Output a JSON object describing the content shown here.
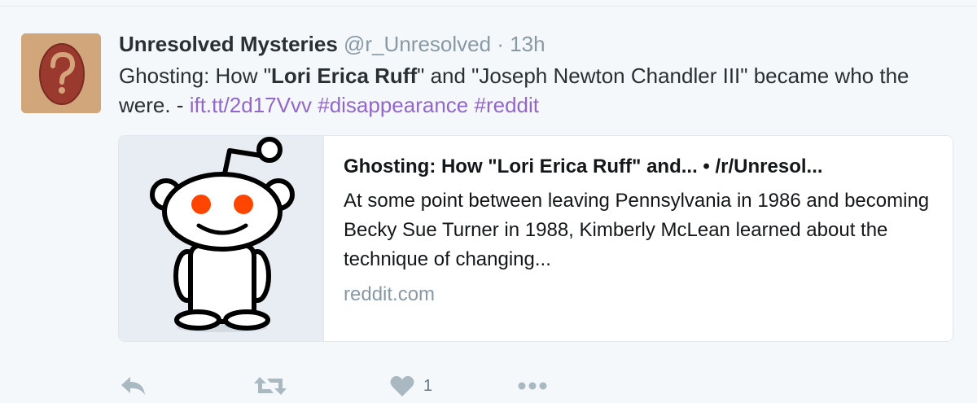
{
  "tweet": {
    "fullname": "Unresolved Mysteries",
    "username": "@r_Unresolved",
    "separator": "·",
    "time": "13h",
    "text_prefix": "Ghosting: How \"",
    "bold_1": "Lori Erica Ruff",
    "text_middle": "\" and \"Joseph Newton Chandler III\" became who the were. - ",
    "link": "ift.tt/2d17Vvv",
    "hashtag_1": "#disappearance",
    "hashtag_2": "#reddit"
  },
  "card": {
    "title": "Ghosting: How \"Lori Erica Ruff\" and... • /r/Unresol...",
    "description": "At some point between leaving Pennsylvania in 1986 and becoming Becky Sue Turner in 1988, Kimberly McLean learned about the technique of changing...",
    "domain": "reddit.com",
    "image_icon": "reddit-alien-icon"
  },
  "actions": {
    "reply_icon": "reply-icon",
    "retweet_icon": "retweet-icon",
    "like_icon": "heart-icon",
    "like_count": "1",
    "more_icon": "more-icon"
  },
  "colors": {
    "link": "#9266cc",
    "muted": "#8899a6",
    "reddit_orange": "#ff4500"
  }
}
